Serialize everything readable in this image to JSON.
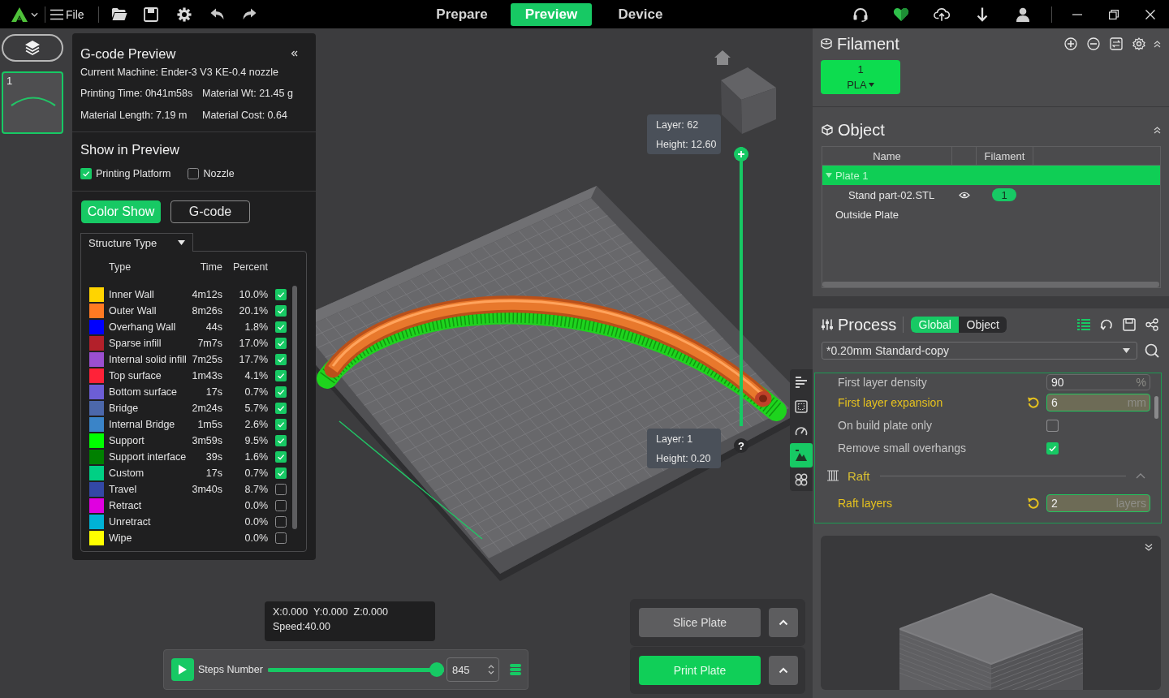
{
  "title_bar": {
    "menu_label": "File",
    "tabs": [
      {
        "label": "Prepare",
        "selected": false
      },
      {
        "label": "Preview",
        "selected": true
      },
      {
        "label": "Device",
        "selected": false
      }
    ]
  },
  "plates": [
    {
      "number": "1",
      "selected": true
    }
  ],
  "gcode_preview": {
    "title": "G-code Preview",
    "machine": "Current Machine: Ender-3 V3 KE-0.4 nozzle",
    "stats": [
      "Printing Time: 0h41m58s",
      "Material Wt: 21.45 g",
      "Material Length: 7.19 m",
      "Material Cost: 0.64"
    ],
    "show_title": "Show in Preview",
    "show_options": [
      {
        "label": "Printing Platform",
        "checked": true
      },
      {
        "label": "Nozzle",
        "checked": false
      }
    ],
    "view_modes": [
      {
        "label": "Color Show",
        "selected": true
      },
      {
        "label": "G-code",
        "selected": false
      }
    ],
    "legend_mode": "Structure Type",
    "legend_columns": [
      "Type",
      "Time",
      "Percent"
    ],
    "legend": [
      {
        "type": "Inner Wall",
        "time": "4m12s",
        "percent": "10.0%",
        "checked": true,
        "color": "#ffd400"
      },
      {
        "type": "Outer Wall",
        "time": "8m26s",
        "percent": "20.1%",
        "checked": true,
        "color": "#ff7a22"
      },
      {
        "type": "Overhang Wall",
        "time": "44s",
        "percent": "1.8%",
        "checked": true,
        "color": "#0000ff"
      },
      {
        "type": "Sparse infill",
        "time": "7m7s",
        "percent": "17.0%",
        "checked": true,
        "color": "#b3202a"
      },
      {
        "type": "Internal solid infill",
        "time": "7m25s",
        "percent": "17.7%",
        "checked": true,
        "color": "#9b4fd0"
      },
      {
        "type": "Top surface",
        "time": "1m43s",
        "percent": "4.1%",
        "checked": true,
        "color": "#ff2238"
      },
      {
        "type": "Bottom surface",
        "time": "17s",
        "percent": "0.7%",
        "checked": true,
        "color": "#6c5ed6"
      },
      {
        "type": "Bridge",
        "time": "2m24s",
        "percent": "5.7%",
        "checked": true,
        "color": "#4c68ab"
      },
      {
        "type": "Internal Bridge",
        "time": "1m5s",
        "percent": "2.6%",
        "checked": true,
        "color": "#3a84c8"
      },
      {
        "type": "Support",
        "time": "3m59s",
        "percent": "9.5%",
        "checked": true,
        "color": "#00ff00"
      },
      {
        "type": "Support interface",
        "time": "39s",
        "percent": "1.6%",
        "checked": true,
        "color": "#008000"
      },
      {
        "type": "Custom",
        "time": "17s",
        "percent": "0.7%",
        "checked": true,
        "color": "#00d084"
      },
      {
        "type": "Travel",
        "time": "3m40s",
        "percent": "8.7%",
        "checked": false,
        "color": "#3348a6"
      },
      {
        "type": "Retract",
        "percent": "0.0%",
        "checked": false,
        "color": "#e000e0"
      },
      {
        "type": "Unretract",
        "percent": "0.0%",
        "checked": false,
        "color": "#00b2d6"
      },
      {
        "type": "Wipe",
        "percent": "0.0%",
        "checked": false,
        "color": "#ffff00"
      }
    ]
  },
  "layer_slider": {
    "level": 1,
    "top_layer": "Layer: 62",
    "top_height": "Height: 12.60",
    "bottom_layer": "Layer: 1",
    "bottom_height": "Height: 0.20",
    "help": "?"
  },
  "view_tools": [
    {
      "selected": false
    },
    {
      "selected": false
    },
    {
      "selected": false
    },
    {
      "selected": true
    },
    {
      "selected": false
    }
  ],
  "position": {
    "coords": [
      "X:0.000",
      "Y:0.000",
      "Z:0.000"
    ],
    "speed": "Speed:40.00"
  },
  "steps": {
    "label": "Steps Number",
    "level": 1,
    "value": "845"
  },
  "plate_actions": [
    {
      "label": "Slice Plate",
      "kind": "secondary"
    },
    {
      "label": "Print Plate",
      "kind": "primary"
    }
  ],
  "filament": {
    "title": "Filament",
    "slots": [
      {
        "number": "1",
        "material": "PLA",
        "color": "#0ddc4f"
      }
    ]
  },
  "object": {
    "title": "Object",
    "columns": [
      "Name",
      "Filament"
    ],
    "tree": [
      {
        "name": "Plate 1",
        "selected": true,
        "expanded": true,
        "children": [
          {
            "name": "Stand part-02.STL",
            "selected": false,
            "visible": true,
            "filament": "1"
          }
        ]
      },
      {
        "name": "Outside Plate",
        "selected": false
      }
    ]
  },
  "process": {
    "title": "Process",
    "scopes": [
      {
        "label": "Global",
        "selected": true
      },
      {
        "label": "Object",
        "selected": false
      }
    ],
    "preset": "*0.20mm Standard-copy",
    "settings": [
      {
        "kind": "number",
        "label": "First layer density",
        "value": "90",
        "unit": "%",
        "modified": false
      },
      {
        "kind": "number",
        "label": "First layer expansion",
        "value": "6",
        "unit": "mm",
        "modified": true
      },
      {
        "kind": "checkbox",
        "label": "On build plate only",
        "checked": false,
        "modified": false
      },
      {
        "kind": "checkbox",
        "label": "Remove small overhangs",
        "checked": true,
        "modified": false
      },
      {
        "kind": "section",
        "label": "Raft",
        "expanded": true
      },
      {
        "kind": "number",
        "label": "Raft layers",
        "value": "2",
        "unit": "layers",
        "modified": true
      }
    ]
  }
}
